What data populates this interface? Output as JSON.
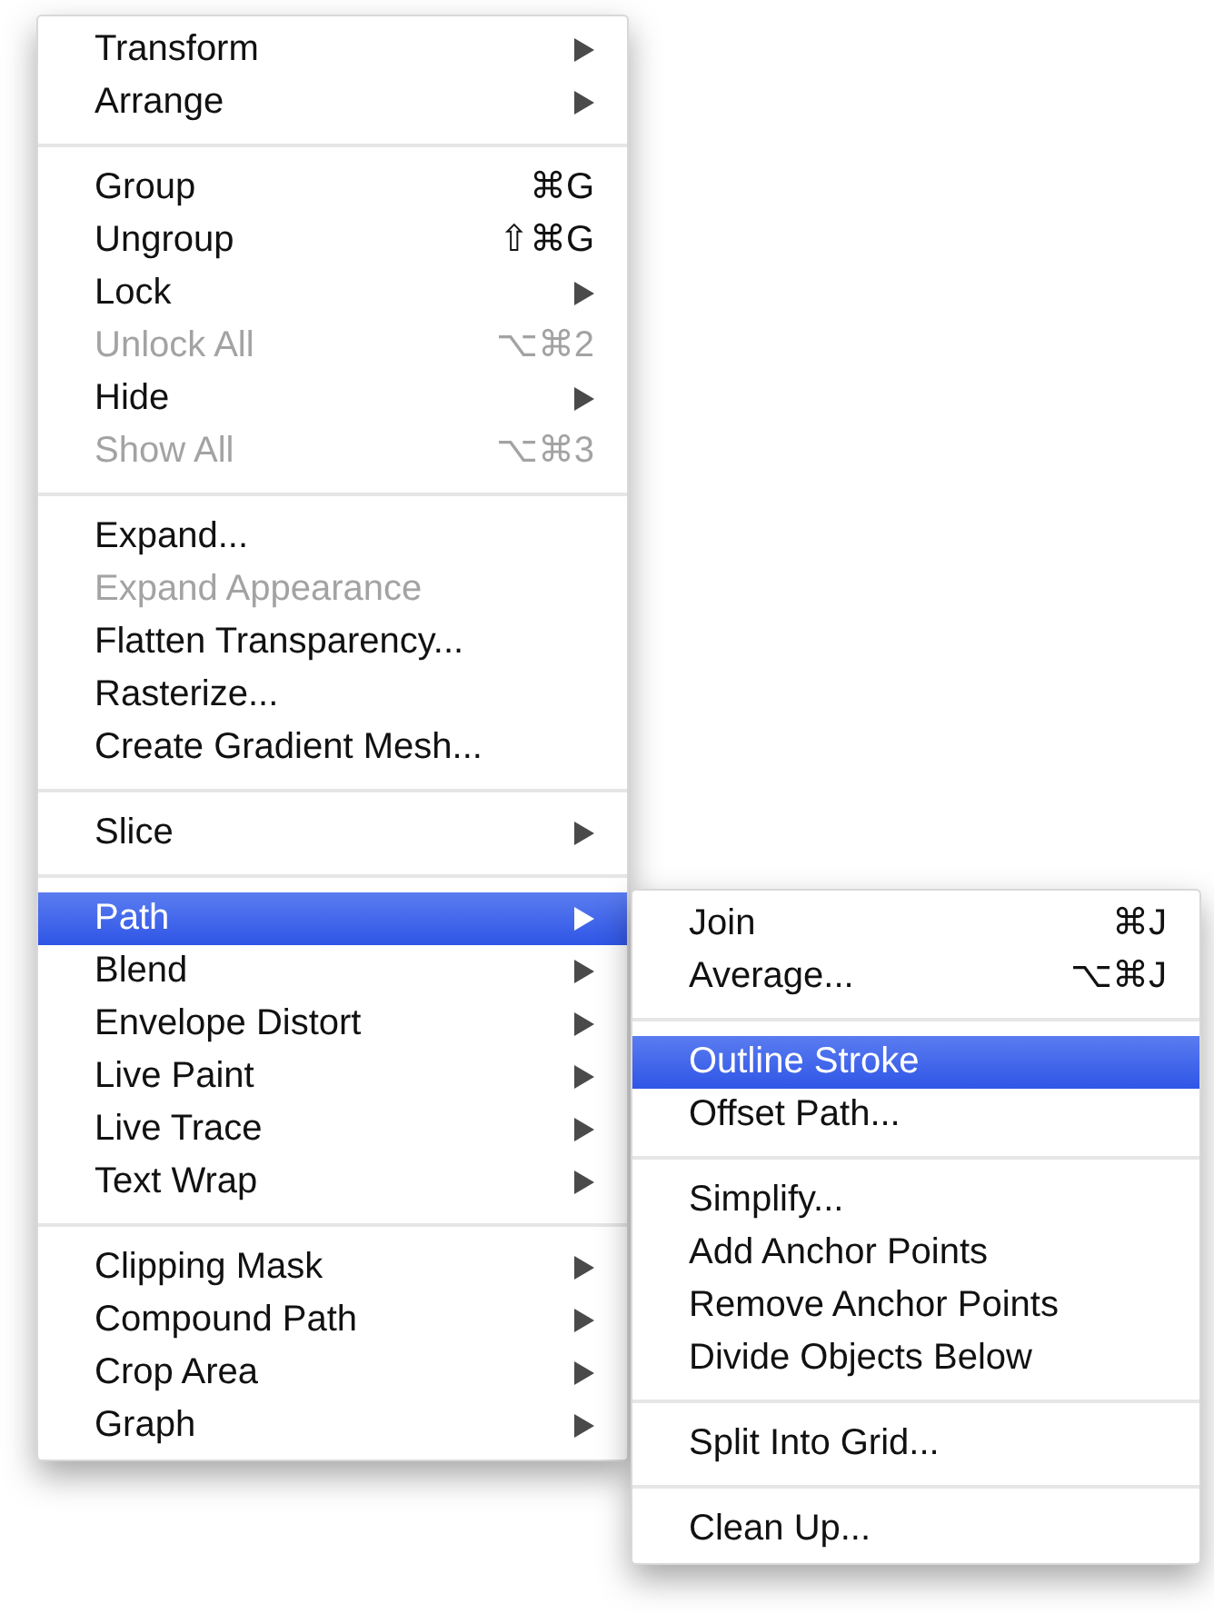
{
  "menu": {
    "groups": [
      {
        "items": [
          {
            "label": "Transform",
            "submenu": true,
            "disabled": false,
            "selected": false
          },
          {
            "label": "Arrange",
            "submenu": true,
            "disabled": false,
            "selected": false
          }
        ]
      },
      {
        "items": [
          {
            "label": "Group",
            "shortcut": "⌘G",
            "submenu": false,
            "disabled": false,
            "selected": false
          },
          {
            "label": "Ungroup",
            "shortcut": "⇧⌘G",
            "submenu": false,
            "disabled": false,
            "selected": false
          },
          {
            "label": "Lock",
            "submenu": true,
            "disabled": false,
            "selected": false
          },
          {
            "label": "Unlock All",
            "shortcut": "⌥⌘2",
            "submenu": false,
            "disabled": true,
            "selected": false
          },
          {
            "label": "Hide",
            "submenu": true,
            "disabled": false,
            "selected": false
          },
          {
            "label": "Show All",
            "shortcut": "⌥⌘3",
            "submenu": false,
            "disabled": true,
            "selected": false
          }
        ]
      },
      {
        "items": [
          {
            "label": "Expand...",
            "submenu": false,
            "disabled": false,
            "selected": false
          },
          {
            "label": "Expand Appearance",
            "submenu": false,
            "disabled": true,
            "selected": false
          },
          {
            "label": "Flatten Transparency...",
            "submenu": false,
            "disabled": false,
            "selected": false
          },
          {
            "label": "Rasterize...",
            "submenu": false,
            "disabled": false,
            "selected": false
          },
          {
            "label": "Create Gradient Mesh...",
            "submenu": false,
            "disabled": false,
            "selected": false
          }
        ]
      },
      {
        "items": [
          {
            "label": "Slice",
            "submenu": true,
            "disabled": false,
            "selected": false
          }
        ]
      },
      {
        "items": [
          {
            "label": "Path",
            "submenu": true,
            "disabled": false,
            "selected": true
          },
          {
            "label": "Blend",
            "submenu": true,
            "disabled": false,
            "selected": false
          },
          {
            "label": "Envelope Distort",
            "submenu": true,
            "disabled": false,
            "selected": false
          },
          {
            "label": "Live Paint",
            "submenu": true,
            "disabled": false,
            "selected": false
          },
          {
            "label": "Live Trace",
            "submenu": true,
            "disabled": false,
            "selected": false
          },
          {
            "label": "Text Wrap",
            "submenu": true,
            "disabled": false,
            "selected": false
          }
        ]
      },
      {
        "items": [
          {
            "label": "Clipping Mask",
            "submenu": true,
            "disabled": false,
            "selected": false
          },
          {
            "label": "Compound Path",
            "submenu": true,
            "disabled": false,
            "selected": false
          },
          {
            "label": "Crop Area",
            "submenu": true,
            "disabled": false,
            "selected": false
          },
          {
            "label": "Graph",
            "submenu": true,
            "disabled": false,
            "selected": false
          }
        ]
      }
    ]
  },
  "submenu": {
    "groups": [
      {
        "items": [
          {
            "label": "Join",
            "shortcut": "⌘J",
            "submenu": false,
            "disabled": false,
            "selected": false
          },
          {
            "label": "Average...",
            "shortcut": "⌥⌘J",
            "submenu": false,
            "disabled": false,
            "selected": false
          }
        ]
      },
      {
        "items": [
          {
            "label": "Outline Stroke",
            "submenu": false,
            "disabled": false,
            "selected": true
          },
          {
            "label": "Offset Path...",
            "submenu": false,
            "disabled": false,
            "selected": false
          }
        ]
      },
      {
        "items": [
          {
            "label": "Simplify...",
            "submenu": false,
            "disabled": false,
            "selected": false
          },
          {
            "label": "Add Anchor Points",
            "submenu": false,
            "disabled": false,
            "selected": false
          },
          {
            "label": "Remove Anchor Points",
            "submenu": false,
            "disabled": false,
            "selected": false
          },
          {
            "label": "Divide Objects Below",
            "submenu": false,
            "disabled": false,
            "selected": false
          }
        ]
      },
      {
        "items": [
          {
            "label": "Split Into Grid...",
            "submenu": false,
            "disabled": false,
            "selected": false
          }
        ]
      },
      {
        "items": [
          {
            "label": "Clean Up...",
            "submenu": false,
            "disabled": false,
            "selected": false
          }
        ]
      }
    ]
  }
}
